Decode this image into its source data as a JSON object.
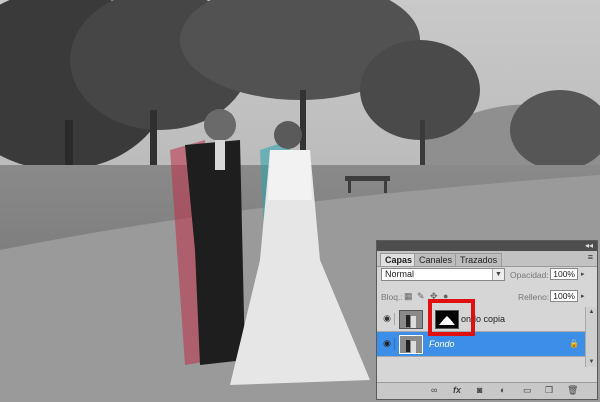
{
  "panel": {
    "collapse_label": "◂◂",
    "tabs": [
      {
        "label": "Capas",
        "active": true
      },
      {
        "label": "Canales",
        "active": false
      },
      {
        "label": "Trazados",
        "active": false
      }
    ],
    "menu_icon": "≡",
    "blend_mode": "Normal",
    "opacity_label": "Opacidad:",
    "opacity_value": "100%",
    "lock_label": "Bloq.:",
    "fill_label": "Relleno:",
    "fill_value": "100%",
    "layers": [
      {
        "name": "Fondo copia",
        "visible_name": "ondo copia",
        "selected": false,
        "has_mask": true
      },
      {
        "name": "Fondo",
        "visible_name": "Fondo",
        "selected": true,
        "locked": true
      }
    ]
  },
  "colors": {
    "selection": "#3d8ee6",
    "highlight_box": "#e01010",
    "panel_bg": "#d6d6d6"
  },
  "icons": {
    "eye": "eye-icon",
    "lock": "lock-icon",
    "link": "link-icon",
    "fx": "fx-icon",
    "mask": "add-mask-icon",
    "adjust": "adjustment-layer-icon",
    "group": "new-group-icon",
    "new": "new-layer-icon",
    "trash": "trash-icon"
  }
}
